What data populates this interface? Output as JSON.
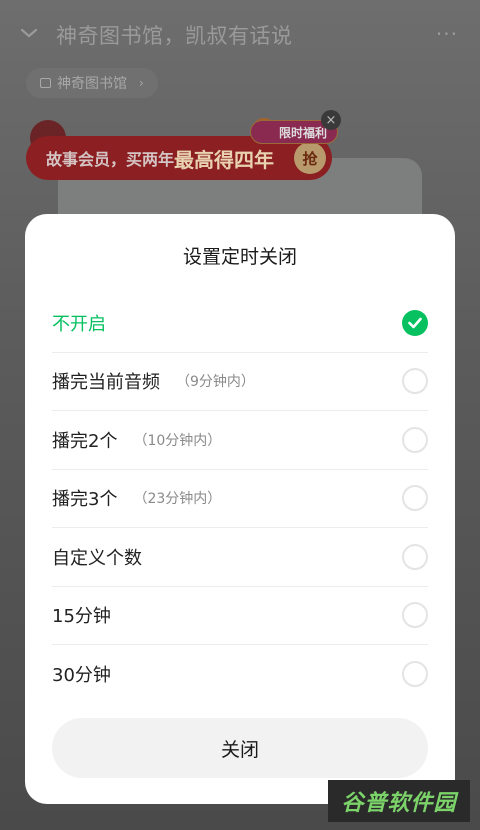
{
  "header": {
    "title": "神奇图书馆，凯叔有话说",
    "more": "···",
    "tag": "神奇图书馆",
    "tag_arrow": "›"
  },
  "promo": {
    "text_prefix": "故事会员，买两年",
    "text_highlight": "最高得四年",
    "grab": "抢",
    "pill": "限时福利",
    "close": "×"
  },
  "sheet": {
    "title": "设置定时关闭",
    "options": [
      {
        "label": "不开启",
        "note": "",
        "selected": true
      },
      {
        "label": "播完当前音频",
        "note": "（9分钟内）",
        "selected": false
      },
      {
        "label": "播完2个",
        "note": "（10分钟内）",
        "selected": false
      },
      {
        "label": "播完3个",
        "note": "（23分钟内）",
        "selected": false
      },
      {
        "label": "自定义个数",
        "note": "",
        "selected": false
      },
      {
        "label": "15分钟",
        "note": "",
        "selected": false
      },
      {
        "label": "30分钟",
        "note": "",
        "selected": false
      }
    ],
    "close_label": "关闭"
  },
  "watermark": "谷普软件园",
  "colors": {
    "accent": "#07c160",
    "overlay": "#5a5a5a",
    "sheet_bg": "#ffffff"
  }
}
